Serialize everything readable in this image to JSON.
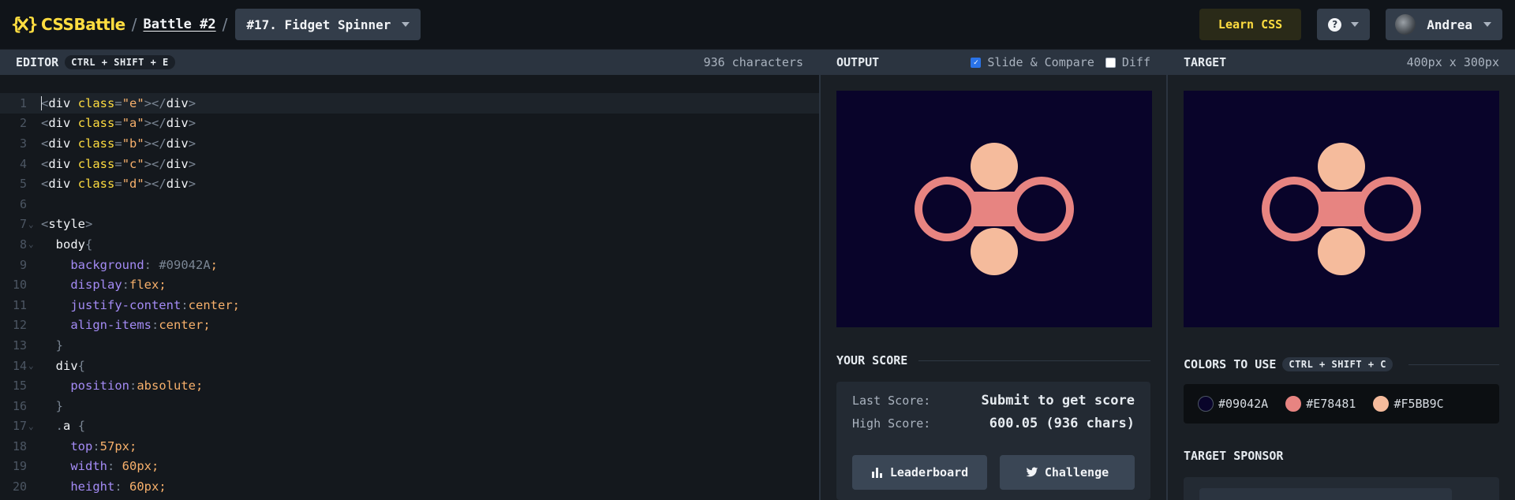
{
  "header": {
    "logo_text": "CSSBattle",
    "breadcrumb_separator": "/",
    "battle_label": "Battle #2",
    "target_select_label": "#17. Fidget Spinner",
    "learn_label": "Learn CSS",
    "help_symbol": "?",
    "user_name": "Andrea",
    "brand_color": "#FFDD40"
  },
  "editor": {
    "title": "EDITOR",
    "shortcut": "CTRL + SHIFT + E",
    "char_count": "936 characters",
    "line_numbers": [
      "1",
      "2",
      "3",
      "4",
      "5",
      "6",
      "7",
      "8",
      "9",
      "10",
      "11",
      "12",
      "13",
      "14",
      "15",
      "16",
      "17",
      "18",
      "19",
      "20"
    ]
  },
  "output": {
    "title": "OUTPUT",
    "slide_compare_label": "Slide & Compare",
    "slide_compare_checked": true,
    "diff_label": "Diff",
    "diff_checked": false,
    "score_section_title": "YOUR SCORE",
    "last_score_label": "Last Score:",
    "last_score_value": "Submit to get score",
    "high_score_label": "High Score:",
    "high_score_value": "600.05 (936 chars)",
    "leaderboard_label": "Leaderboard",
    "challenge_label": "Challenge"
  },
  "target": {
    "title": "TARGET",
    "dimensions": "400px x 300px",
    "colors_title": "COLORS TO USE",
    "colors_shortcut": "CTRL + SHIFT + C",
    "colors": [
      "#09042A",
      "#E78481",
      "#F5BB9C"
    ],
    "sponsor_title": "TARGET SPONSOR"
  }
}
